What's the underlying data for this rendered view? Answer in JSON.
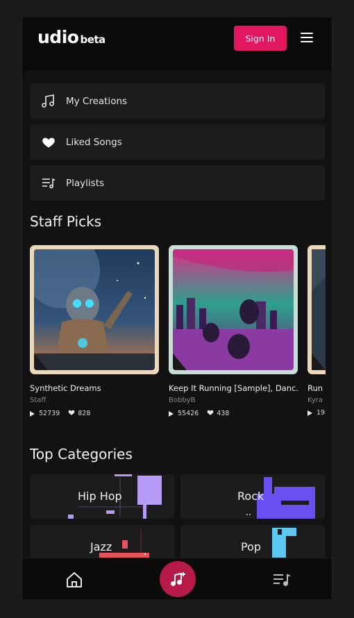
{
  "header": {
    "logo": "udio",
    "logo_suffix": "beta",
    "sign_in_label": "Sign In",
    "menu_icon": "hamburger-menu-icon"
  },
  "nav": [
    {
      "label": "My Creations",
      "icon": "music-note-icon"
    },
    {
      "label": "Liked Songs",
      "icon": "heart-icon"
    },
    {
      "label": "Playlists",
      "icon": "playlist-icon"
    }
  ],
  "staff_picks": {
    "title": "Staff Picks",
    "cards": [
      {
        "title": "Synthetic Dreams",
        "artist": "Staff",
        "plays": "52739",
        "likes": "828"
      },
      {
        "title": "Keep It Running [Sample], Danc...",
        "artist": "BobbyB",
        "plays": "55426",
        "likes": "438"
      },
      {
        "title": "Run",
        "artist": "Kyra",
        "plays": "19",
        "likes": ""
      }
    ]
  },
  "top_categories": {
    "title": "Top Categories",
    "items": [
      {
        "label": "Hip Hop",
        "accent": "#b79cf5"
      },
      {
        "label": "Rock",
        "accent": "#6a4ff0"
      },
      {
        "label": "Jazz",
        "accent": "#e8505b"
      },
      {
        "label": "Pop",
        "accent": "#5cc8f0"
      }
    ]
  },
  "bottom_nav": {
    "home_icon": "home-icon",
    "create_icon": "music-plus-icon",
    "queue_icon": "queue-icon"
  },
  "colors": {
    "brand": "#e3175f",
    "create_button": "#b51a48",
    "background": "#0b0b0b",
    "surface": "#1c1c1c"
  }
}
